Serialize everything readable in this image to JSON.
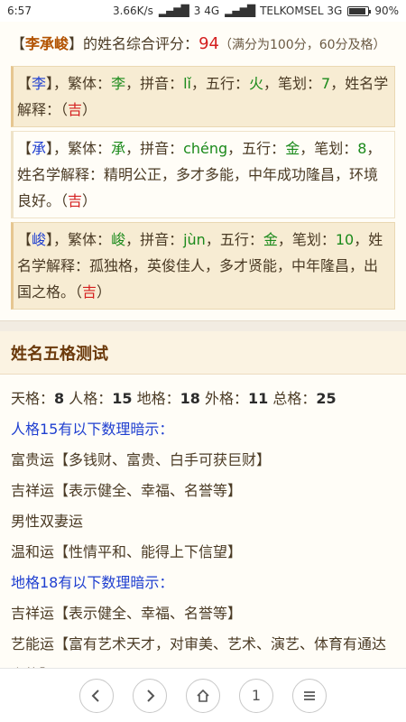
{
  "status": {
    "time": "6:57",
    "network_speed": "3.66K/s",
    "sim1": "3 4G",
    "carrier": "TELKOMSEL 3G",
    "battery": "90%",
    "battery_level": 0.9
  },
  "summary": {
    "bracket_open": "【",
    "name": "李承峻",
    "bracket_close": "】",
    "label": "的姓名综合评分：",
    "score": "94",
    "note": "（满分为100分，60分及格）"
  },
  "chars": [
    {
      "char": "李",
      "trad_label": "，繁体：",
      "trad": "李",
      "pinyin_label": "，拼音：",
      "pinyin": "lǐ",
      "wuxing_label": "，五行：",
      "wuxing": "火",
      "strokes_label": "，笔划：",
      "strokes": "7",
      "interp_label": "，姓名学解释：",
      "interp": "",
      "luck": "吉"
    },
    {
      "char": "承",
      "trad_label": "，繁体：",
      "trad": "承",
      "pinyin_label": "，拼音：",
      "pinyin": "chéng",
      "wuxing_label": "，五行：",
      "wuxing": "金",
      "strokes_label": "，笔划：",
      "strokes": "8",
      "interp_label": "，姓名学解释：",
      "interp": "精明公正，多才多能，中年成功隆昌，环境良好。",
      "luck": "吉"
    },
    {
      "char": "峻",
      "trad_label": "，繁体：",
      "trad": "峻",
      "pinyin_label": "，拼音：",
      "pinyin": "jùn",
      "wuxing_label": "，五行：",
      "wuxing": "金",
      "strokes_label": "，笔划：",
      "strokes": "10",
      "interp_label": "，姓名学解释：",
      "interp": "孤独格，英俊佳人，多才贤能，中年隆昌，出国之格。",
      "luck": "吉"
    }
  ],
  "section": {
    "title": "姓名五格测试"
  },
  "five_grid": {
    "tian_label": "天格：",
    "tian": "8",
    "ren_label": "人格：",
    "ren": "15",
    "di_label": "地格：",
    "di": "18",
    "wai_label": "外格：",
    "wai": "11",
    "zong_label": "总格：",
    "zong": "25",
    "ren_heading": "人格15有以下数理暗示：",
    "ren_lines": [
      "富贵运【多钱财、富贵、白手可获巨财】",
      "吉祥运【表示健全、幸福、名誉等】",
      "男性双妻运",
      "温和运【性情平和、能得上下信望】"
    ],
    "di_heading": "地格18有以下数理暗示：",
    "di_lines": [
      "吉祥运【表示健全、幸福、名誉等】",
      "艺能运【富有艺术天才，对审美、艺术、演艺、体育有通达之能】"
    ]
  },
  "nav": {
    "back_icon": "chevron-left-icon",
    "forward_icon": "chevron-right-icon",
    "home_icon": "home-icon",
    "tab_count": "1",
    "menu_icon": "menu-icon"
  }
}
